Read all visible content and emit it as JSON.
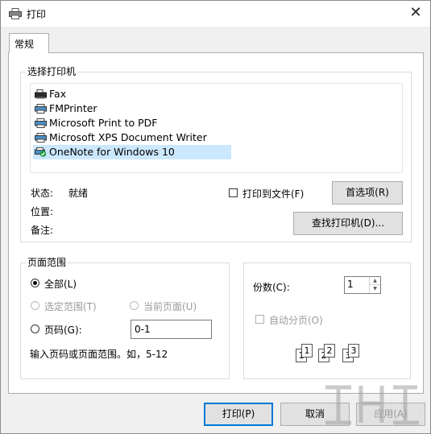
{
  "window": {
    "title": "打印",
    "close_glyph": "✕"
  },
  "tabs": [
    {
      "label": "常规"
    }
  ],
  "select_printer": {
    "group_label": "选择打印机",
    "printers": [
      {
        "name": "Fax",
        "icon": "fax-icon",
        "selected": false
      },
      {
        "name": "FMPrinter",
        "icon": "printer-icon",
        "selected": false
      },
      {
        "name": "Microsoft Print to PDF",
        "icon": "printer-icon",
        "selected": false
      },
      {
        "name": "Microsoft XPS Document Writer",
        "icon": "printer-icon",
        "selected": false
      },
      {
        "name": "OneNote for Windows 10",
        "icon": "default-printer-icon",
        "selected": true
      }
    ],
    "status_label": "状态:",
    "status_value": "就绪",
    "location_label": "位置:",
    "comment_label": "备注:",
    "print_to_file_label": "打印到文件(F)",
    "print_to_file_checked": false,
    "preferences_button": "首选项(R)",
    "find_printer_button": "查找打印机(D)..."
  },
  "page_range": {
    "group_label": "页面范围",
    "all_label": "全部(L)",
    "selection_label": "选定范围(T)",
    "current_page_label": "当前页面(U)",
    "pages_label": "页码(G):",
    "pages_value": "0-1",
    "hint": "输入页码或页面范围。如，5-12",
    "selected_option": "all"
  },
  "copies": {
    "label": "份数(C):",
    "value": "1",
    "collate_label": "自动分页(O)",
    "collate_checked": false,
    "collate_pages": [
      "1",
      "1",
      "2",
      "2",
      "3",
      "3"
    ]
  },
  "footer": {
    "print_button": "打印(P)",
    "cancel_button": "取消",
    "apply_button": "应用(A)"
  },
  "colors": {
    "accent": "#0078d7",
    "selection": "#cce8ff",
    "disabled_text": "#9a9a9a"
  }
}
